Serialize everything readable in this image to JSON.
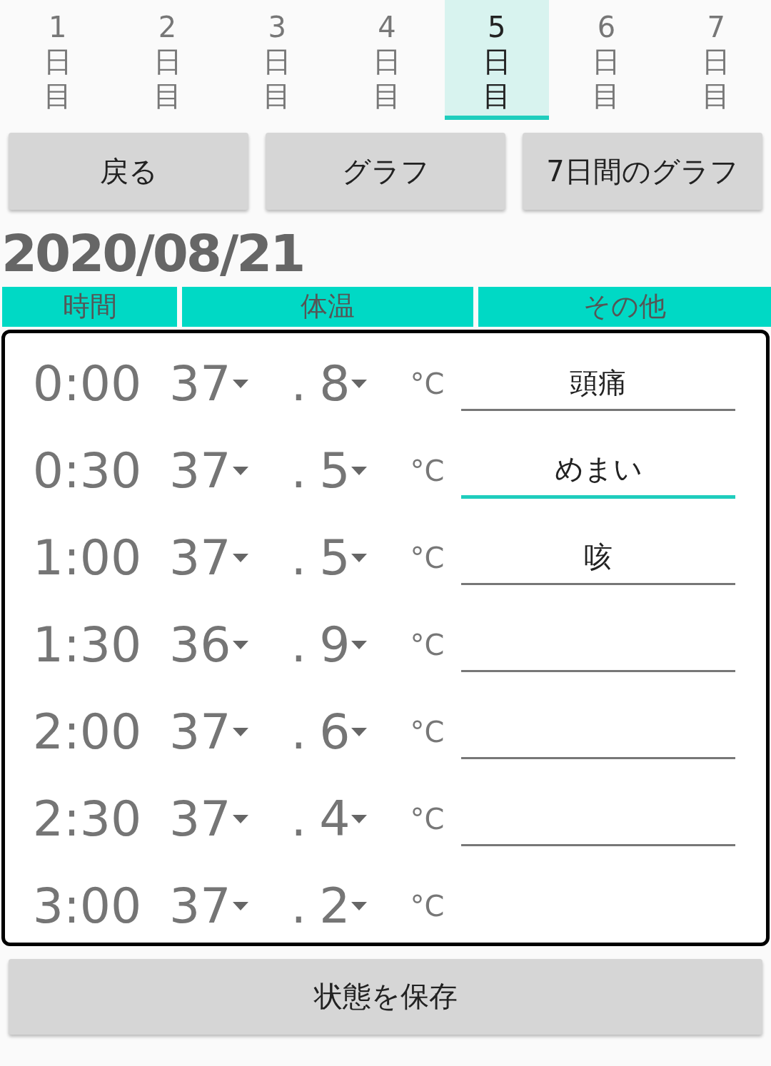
{
  "tabs": [
    {
      "label": "1日目",
      "selected": false
    },
    {
      "label": "2日目",
      "selected": false
    },
    {
      "label": "3日目",
      "selected": false
    },
    {
      "label": "4日目",
      "selected": false
    },
    {
      "label": "5日目",
      "selected": true
    },
    {
      "label": "6日目",
      "selected": false
    },
    {
      "label": "7日目",
      "selected": false
    }
  ],
  "buttons": [
    "戻る",
    "グラフ",
    "7日間のグラフ"
  ],
  "date": "2020/08/21",
  "columns": [
    "時間",
    "体温",
    "その他"
  ],
  "rows": [
    {
      "time": "0:00",
      "integer": "37",
      "decimal": "8",
      "unit": "°C",
      "separator": ".",
      "field": {
        "value": "頭痛",
        "focused": false
      }
    },
    {
      "time": "0:30",
      "integer": "37",
      "decimal": "5",
      "unit": "°C",
      "separator": ".",
      "field": {
        "value": "めまい",
        "focused": true
      }
    },
    {
      "time": "1:00",
      "integer": "37",
      "decimal": "5",
      "unit": "°C",
      "separator": ".",
      "field": {
        "value": "咳",
        "focused": false
      }
    },
    {
      "time": "1:30",
      "integer": "36",
      "decimal": "9",
      "unit": "°C",
      "separator": ".",
      "field": {
        "focused": false
      }
    },
    {
      "time": "2:00",
      "integer": "37",
      "decimal": "6",
      "unit": "°C",
      "separator": ".",
      "field": {
        "focused": false
      }
    },
    {
      "time": "2:30",
      "integer": "37",
      "decimal": "4",
      "unit": "°C",
      "separator": ".",
      "field": {
        "focused": false
      }
    },
    {
      "time": "3:00",
      "integer": "37",
      "decimal": "2",
      "unit": "°C",
      "separator": "."
    }
  ],
  "save_button": "状態を保存"
}
